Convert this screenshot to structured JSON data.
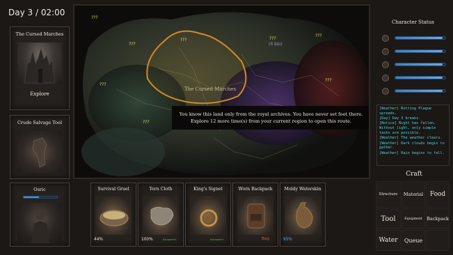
{
  "header": {
    "day_time": "Day 3 / 02:00"
  },
  "location_card": {
    "title": "The Cursed Marches",
    "action": "Explore"
  },
  "tool_card": {
    "title": "Crude Salvage Tool"
  },
  "character_card": {
    "name": "Osric",
    "health": 0.45
  },
  "map": {
    "region_label": "The Cursed Marches",
    "known_region_label": "(8 km)",
    "unknown_marker": "???",
    "tooltip_line1": "You know this land only from the royal archives. You have never set foot there.",
    "tooltip_line2": "Explore 12 more time(s) from your current region to open this route."
  },
  "character_status": {
    "title": "Character Status",
    "stats": [
      {
        "icon": "heart-icon",
        "value": 0.95
      },
      {
        "icon": "stomach-icon",
        "value": 0.95
      },
      {
        "icon": "water-drop-icon",
        "value": 0.95
      },
      {
        "icon": "fatigue-icon",
        "value": 0.95
      },
      {
        "icon": "sanity-icon",
        "value": 0.95
      }
    ]
  },
  "event_log": [
    "[Weather] Rotting Plague spreads.",
    "[Day] Day 3 breaks.",
    "[Notice] Night has fallen. Without light, only simple tasks are possible.",
    "[Weather] The weather clears.",
    "[Weather] Dark clouds begin to gather.",
    "[Weather] Rain begins to fall."
  ],
  "inventory": [
    {
      "name": "Survival Gruel",
      "percent": "44%",
      "tag": "",
      "tag_color": "#4fbf4f"
    },
    {
      "name": "Torn Cloth",
      "percent": "100%",
      "tag": "Equipment",
      "tag_color": "#4fbf4f"
    },
    {
      "name": "King's Signet",
      "percent": "",
      "tag": "Equipment",
      "tag_color": "#4fbf4f"
    },
    {
      "name": "Worn Backpack",
      "percent": "",
      "tag": "Bag",
      "tag_color": "#e05a2a"
    },
    {
      "name": "Moldy Waterskin",
      "percent": "95%",
      "tag": "",
      "tag_color": "#4fbf4f",
      "percent_color": "#4fa8ff"
    }
  ],
  "craft": {
    "title": "Craft",
    "structure": "Structure",
    "material": "Material",
    "food": "Food",
    "tool": "Tool",
    "equipment": "Equipment",
    "backpack": "Backpack",
    "water": "Water",
    "queue": "Queue"
  },
  "colors": {
    "log_text": "#4fd3e0",
    "bar_fill": "#4a8ed0",
    "region_outline": "#d48a24",
    "map_marker": "#e8dc7a"
  }
}
